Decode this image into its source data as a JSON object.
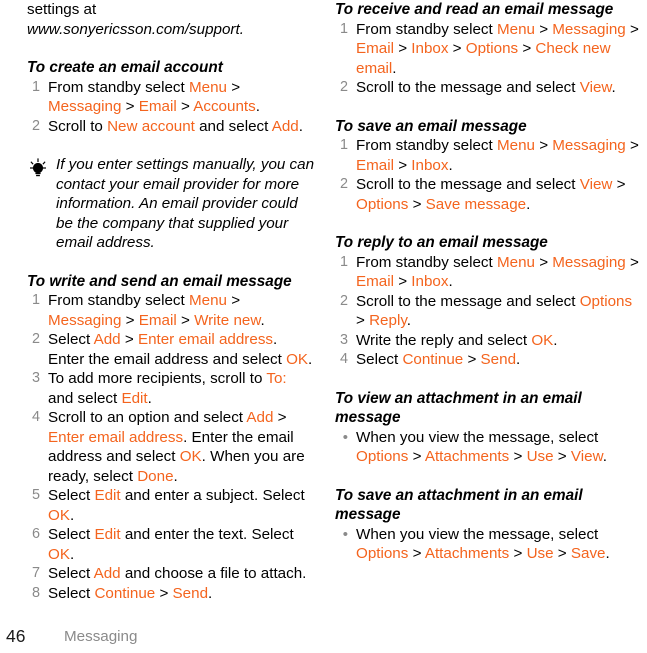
{
  "colors": {
    "menu_orange": "#f4641e",
    "body_text": "#000000",
    "muted_gray": "#8a8a8a",
    "page_background": "#ffffff"
  },
  "footer": {
    "page_number": "46",
    "section": "Messaging"
  },
  "left_column": {
    "intro": {
      "line1": "settings at",
      "line2": "www.sonyericsson.com/support."
    },
    "section_create_account": {
      "heading": "To create an email account",
      "steps": [
        {
          "number": "1",
          "parts": [
            {
              "text": "From standby select ",
              "style": "plain"
            },
            {
              "text": "Menu",
              "style": "menu"
            },
            {
              "text": " > ",
              "style": "plain"
            },
            {
              "text": "Messaging",
              "style": "menu"
            },
            {
              "text": " > ",
              "style": "plain"
            },
            {
              "text": "Email",
              "style": "menu"
            },
            {
              "text": " > ",
              "style": "plain"
            },
            {
              "text": "Accounts",
              "style": "menu"
            },
            {
              "text": ".",
              "style": "plain"
            }
          ]
        },
        {
          "number": "2",
          "parts": [
            {
              "text": "Scroll to ",
              "style": "plain"
            },
            {
              "text": "New account",
              "style": "menu"
            },
            {
              "text": " and select ",
              "style": "plain"
            },
            {
              "text": "Add",
              "style": "menu"
            },
            {
              "text": ".",
              "style": "plain"
            }
          ]
        }
      ]
    },
    "tip": {
      "icon": "lightbulb-icon",
      "text": "If you enter settings manually, you can contact your email provider for more information. An email provider could be the company that supplied your email address."
    },
    "section_write_send": {
      "heading": "To write and send an email message",
      "steps": [
        {
          "number": "1",
          "parts": [
            {
              "text": "From standby select ",
              "style": "plain"
            },
            {
              "text": "Menu",
              "style": "menu"
            },
            {
              "text": " > ",
              "style": "plain"
            },
            {
              "text": "Messaging",
              "style": "menu"
            },
            {
              "text": " > ",
              "style": "plain"
            },
            {
              "text": "Email",
              "style": "menu"
            },
            {
              "text": " > ",
              "style": "plain"
            },
            {
              "text": "Write new",
              "style": "menu"
            },
            {
              "text": ".",
              "style": "plain"
            }
          ]
        },
        {
          "number": "2",
          "parts": [
            {
              "text": "Select ",
              "style": "plain"
            },
            {
              "text": "Add",
              "style": "menu"
            },
            {
              "text": " > ",
              "style": "plain"
            },
            {
              "text": "Enter email address",
              "style": "menu"
            },
            {
              "text": ". Enter the email address and select ",
              "style": "plain"
            },
            {
              "text": "OK",
              "style": "menu"
            },
            {
              "text": ".",
              "style": "plain"
            }
          ]
        },
        {
          "number": "3",
          "parts": [
            {
              "text": "To add more recipients, scroll to ",
              "style": "plain"
            },
            {
              "text": "To:",
              "style": "menu"
            },
            {
              "text": " and select ",
              "style": "plain"
            },
            {
              "text": "Edit",
              "style": "menu"
            },
            {
              "text": ".",
              "style": "plain"
            }
          ]
        },
        {
          "number": "4",
          "parts": [
            {
              "text": "Scroll to an option and select ",
              "style": "plain"
            },
            {
              "text": "Add",
              "style": "menu"
            },
            {
              "text": " > ",
              "style": "plain"
            },
            {
              "text": "Enter email address",
              "style": "menu"
            },
            {
              "text": ". Enter the email address and select ",
              "style": "plain"
            },
            {
              "text": "OK",
              "style": "menu"
            },
            {
              "text": ". When you are ready, select ",
              "style": "plain"
            },
            {
              "text": "Done",
              "style": "menu"
            },
            {
              "text": ".",
              "style": "plain"
            }
          ]
        },
        {
          "number": "5",
          "parts": [
            {
              "text": "Select ",
              "style": "plain"
            },
            {
              "text": "Edit",
              "style": "menu"
            },
            {
              "text": " and enter a subject. Select ",
              "style": "plain"
            },
            {
              "text": "OK",
              "style": "menu"
            },
            {
              "text": ".",
              "style": "plain"
            }
          ]
        },
        {
          "number": "6",
          "parts": [
            {
              "text": "Select ",
              "style": "plain"
            },
            {
              "text": "Edit",
              "style": "menu"
            },
            {
              "text": " and enter the text. Select ",
              "style": "plain"
            },
            {
              "text": "OK",
              "style": "menu"
            },
            {
              "text": ".",
              "style": "plain"
            }
          ]
        },
        {
          "number": "7",
          "parts": [
            {
              "text": "Select ",
              "style": "plain"
            },
            {
              "text": "Add",
              "style": "menu"
            },
            {
              "text": " and choose a file to attach.",
              "style": "plain"
            }
          ]
        },
        {
          "number": "8",
          "parts": [
            {
              "text": "Select ",
              "style": "plain"
            },
            {
              "text": "Continue",
              "style": "menu"
            },
            {
              "text": " > ",
              "style": "plain"
            },
            {
              "text": "Send",
              "style": "menu"
            },
            {
              "text": ".",
              "style": "plain"
            }
          ]
        }
      ]
    }
  },
  "right_column": {
    "section_receive_read": {
      "heading": "To receive and read an email message",
      "steps": [
        {
          "number": "1",
          "parts": [
            {
              "text": "From standby select ",
              "style": "plain"
            },
            {
              "text": "Menu",
              "style": "menu"
            },
            {
              "text": " > ",
              "style": "plain"
            },
            {
              "text": "Messaging",
              "style": "menu"
            },
            {
              "text": " > ",
              "style": "plain"
            },
            {
              "text": "Email",
              "style": "menu"
            },
            {
              "text": " > ",
              "style": "plain"
            },
            {
              "text": "Inbox",
              "style": "menu"
            },
            {
              "text": " > ",
              "style": "plain"
            },
            {
              "text": "Options",
              "style": "menu"
            },
            {
              "text": " > ",
              "style": "plain"
            },
            {
              "text": "Check new email",
              "style": "menu"
            },
            {
              "text": ".",
              "style": "plain"
            }
          ]
        },
        {
          "number": "2",
          "parts": [
            {
              "text": "Scroll to the message and select ",
              "style": "plain"
            },
            {
              "text": "View",
              "style": "menu"
            },
            {
              "text": ".",
              "style": "plain"
            }
          ]
        }
      ]
    },
    "section_save_message": {
      "heading": "To save an email message",
      "steps": [
        {
          "number": "1",
          "parts": [
            {
              "text": "From standby select ",
              "style": "plain"
            },
            {
              "text": "Menu",
              "style": "menu"
            },
            {
              "text": " > ",
              "style": "plain"
            },
            {
              "text": "Messaging",
              "style": "menu"
            },
            {
              "text": " > ",
              "style": "plain"
            },
            {
              "text": "Email",
              "style": "menu"
            },
            {
              "text": " > ",
              "style": "plain"
            },
            {
              "text": "Inbox",
              "style": "menu"
            },
            {
              "text": ".",
              "style": "plain"
            }
          ]
        },
        {
          "number": "2",
          "parts": [
            {
              "text": "Scroll to the message and select ",
              "style": "plain"
            },
            {
              "text": "View",
              "style": "menu"
            },
            {
              "text": " > ",
              "style": "plain"
            },
            {
              "text": "Options",
              "style": "menu"
            },
            {
              "text": " > ",
              "style": "plain"
            },
            {
              "text": "Save message",
              "style": "menu"
            },
            {
              "text": ".",
              "style": "plain"
            }
          ]
        }
      ]
    },
    "section_reply": {
      "heading": "To reply to an email message",
      "steps": [
        {
          "number": "1",
          "parts": [
            {
              "text": "From standby select ",
              "style": "plain"
            },
            {
              "text": "Menu",
              "style": "menu"
            },
            {
              "text": " > ",
              "style": "plain"
            },
            {
              "text": "Messaging",
              "style": "menu"
            },
            {
              "text": " > ",
              "style": "plain"
            },
            {
              "text": "Email",
              "style": "menu"
            },
            {
              "text": " > ",
              "style": "plain"
            },
            {
              "text": "Inbox",
              "style": "menu"
            },
            {
              "text": ".",
              "style": "plain"
            }
          ]
        },
        {
          "number": "2",
          "parts": [
            {
              "text": "Scroll to the message and select ",
              "style": "plain"
            },
            {
              "text": "Options",
              "style": "menu"
            },
            {
              "text": " > ",
              "style": "plain"
            },
            {
              "text": "Reply",
              "style": "menu"
            },
            {
              "text": ".",
              "style": "plain"
            }
          ]
        },
        {
          "number": "3",
          "parts": [
            {
              "text": "Write the reply and select ",
              "style": "plain"
            },
            {
              "text": "OK",
              "style": "menu"
            },
            {
              "text": ".",
              "style": "plain"
            }
          ]
        },
        {
          "number": "4",
          "parts": [
            {
              "text": "Select ",
              "style": "plain"
            },
            {
              "text": "Continue",
              "style": "menu"
            },
            {
              "text": " > ",
              "style": "plain"
            },
            {
              "text": "Send",
              "style": "menu"
            },
            {
              "text": ".",
              "style": "plain"
            }
          ]
        }
      ]
    },
    "section_view_attachment": {
      "heading": "To view an attachment in an email message",
      "steps": [
        {
          "number": "•",
          "parts": [
            {
              "text": "When you view the message, select ",
              "style": "plain"
            },
            {
              "text": "Options",
              "style": "menu"
            },
            {
              "text": " > ",
              "style": "plain"
            },
            {
              "text": "Attachments",
              "style": "menu"
            },
            {
              "text": " > ",
              "style": "plain"
            },
            {
              "text": "Use",
              "style": "menu"
            },
            {
              "text": " > ",
              "style": "plain"
            },
            {
              "text": "View",
              "style": "menu"
            },
            {
              "text": ".",
              "style": "plain"
            }
          ]
        }
      ]
    },
    "section_save_attachment": {
      "heading": "To save an attachment in an email message",
      "steps": [
        {
          "number": "•",
          "parts": [
            {
              "text": "When you view the message, select ",
              "style": "plain"
            },
            {
              "text": "Options",
              "style": "menu"
            },
            {
              "text": " > ",
              "style": "plain"
            },
            {
              "text": "Attachments",
              "style": "menu"
            },
            {
              "text": " > ",
              "style": "plain"
            },
            {
              "text": "Use",
              "style": "menu"
            },
            {
              "text": " > ",
              "style": "plain"
            },
            {
              "text": "Save",
              "style": "menu"
            },
            {
              "text": ".",
              "style": "plain"
            }
          ]
        }
      ]
    }
  }
}
